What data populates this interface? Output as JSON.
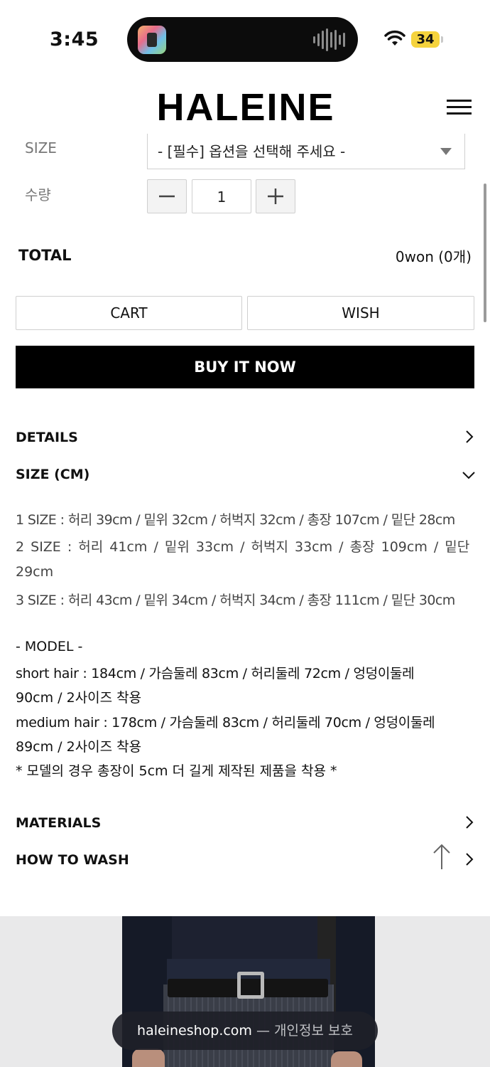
{
  "status_bar": {
    "time": "3:45",
    "battery": "34"
  },
  "header": {
    "logo": "HALEINE",
    "menu_icon": "hamburger-menu-icon"
  },
  "options": {
    "size_label": "SIZE",
    "size_select_value": "- [필수] 옵션을 선택해 주세요 -",
    "qty_label": "수량",
    "qty_value": "1"
  },
  "total": {
    "label": "TOTAL",
    "value": "0won (0개)"
  },
  "actions": {
    "cart": "CART",
    "wish": "WISH",
    "buy_now": "BUY IT NOW"
  },
  "sections": {
    "details": "DETAILS",
    "size_cm": "SIZE (CM)",
    "materials": "MATERIALS",
    "how_to_wash": "HOW TO WASH"
  },
  "size_info": [
    "1 SIZE : 허리 39cm  / 밑위 32cm / 허벅지 32cm / 총장 107cm / 밑단 28cm",
    "2 SIZE : 허리 41cm / 밑위 33cm / 허벅지 33cm / 총장 109cm / 밑단",
    "29cm",
    "3 SIZE : 허리 43cm / 밑위 34cm / 허벅지 34cm / 총장 111cm / 밑단 30cm"
  ],
  "model_info": [
    "- MODEL -",
    "short hair : 184cm / 가슴둘레 83cm / 허리둘레 72cm /  엉덩이둘레",
    "90cm / 2사이즈 착용",
    "medium hair : 178cm / 가슴둘레 83cm / 허리둘레 70cm / 엉덩이둘레",
    "89cm / 2사이즈 착용",
    "* 모델의 경우 총장이 5cm 더 길게 제작된 제품을 착용 *"
  ],
  "url_bar": {
    "host": "haleineshop.com",
    "suffix": " — 개인정보 보호"
  }
}
